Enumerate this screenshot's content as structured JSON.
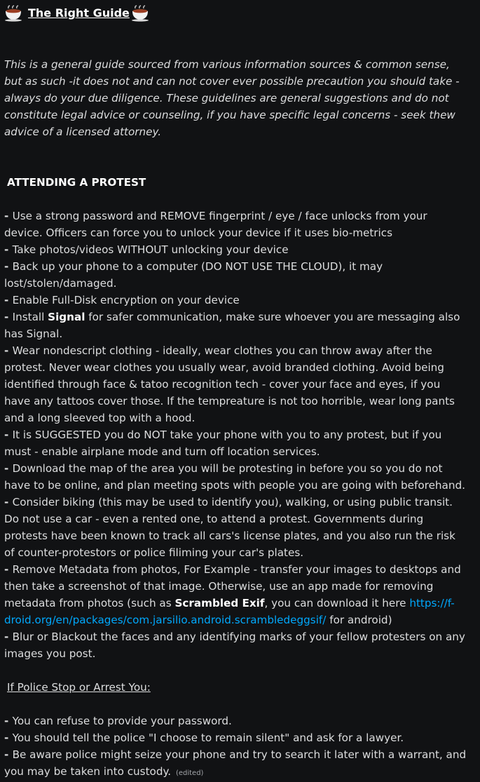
{
  "message": {
    "title": "The Right Guide",
    "title_icon": "coffee-cup-icon",
    "disclaimer": " This is a general guide sourced from various information sources & common sense, but as such -it does not and can not cover ever possible precaution you should take - always do your due diligence. These guidelines are general suggestions and do not constitute legal advice or counseling, if you have specific legal concerns - seek thew advice of a licensed attorney.",
    "section1_heading": "ATTENDING A PROTEST",
    "bullet_dash": " - ",
    "bullets": {
      "b1": "Use a strong password and REMOVE fingerprint / eye / face unlocks from your device. Officers can force you to unlock your device if it uses bio-metrics",
      "b2": "Take photos/videos WITHOUT unlocking your device",
      "b3": "Back up your phone to a computer (DO NOT USE THE CLOUD), it may lost/stolen/damaged.",
      "b4": "Enable Full-Disk encryption on your device",
      "b5_pre": "Install ",
      "b5_bold": "Signal",
      "b5_post": " for safer communication, make sure whoever you are messaging also has Signal.",
      "b6": " Wear nondescript clothing - ideally, wear clothes you can throw away after the protest. Never wear clothes you usually wear, avoid branded clothing. Avoid being identified through face & tatoo recognition tech - cover your face and eyes, if you have any tattoos cover those. If the tempreature is not too horrible, wear long pants and a long sleeved top with a hood.",
      "b7": "It is SUGGESTED you do NOT take your phone with you to any protest, but if you must - enable airplane mode and turn off location services.",
      "b8": "Download the map of the area you will be protesting in before you so you do not have to be online, and plan meeting spots with people you are going with beforehand.",
      "b9": "Consider biking (this may be used to identify you), walking, or using public transit. Do not use a car - even a rented one, to attend a protest. Governments during protests have been known to track all cars's license plates, and you also run the risk of counter-protestors or police filiming your car's plates.",
      "b10_pre": "Remove Metadata from photos, For Example - transfer your images to desktops and then take a screenshot of that image. Otherwise, use an app made for removing metadata from photos (such as ",
      "b10_bold": "Scrambled Exif",
      "b10_mid": ", you can download it here ",
      "b10_link": "https://f-droid.org/en/packages/com.jarsilio.android.scrambledeggsif/",
      "b10_post": " for android)",
      "b11": "Blur or Blackout the faces and any identifying marks of your fellow protesters on any images you post."
    },
    "section2_heading": "If Police Stop or Arrest You:",
    "police": {
      "p1": "You can refuse to provide your password.",
      "p2": "You should tell the police \"I choose to remain silent\" and ask for a lawyer.",
      "p3": "Be aware police might seize your phone and try to search it later with a warrant, and you may be taken into custody."
    },
    "edited_label": "(edited)"
  }
}
